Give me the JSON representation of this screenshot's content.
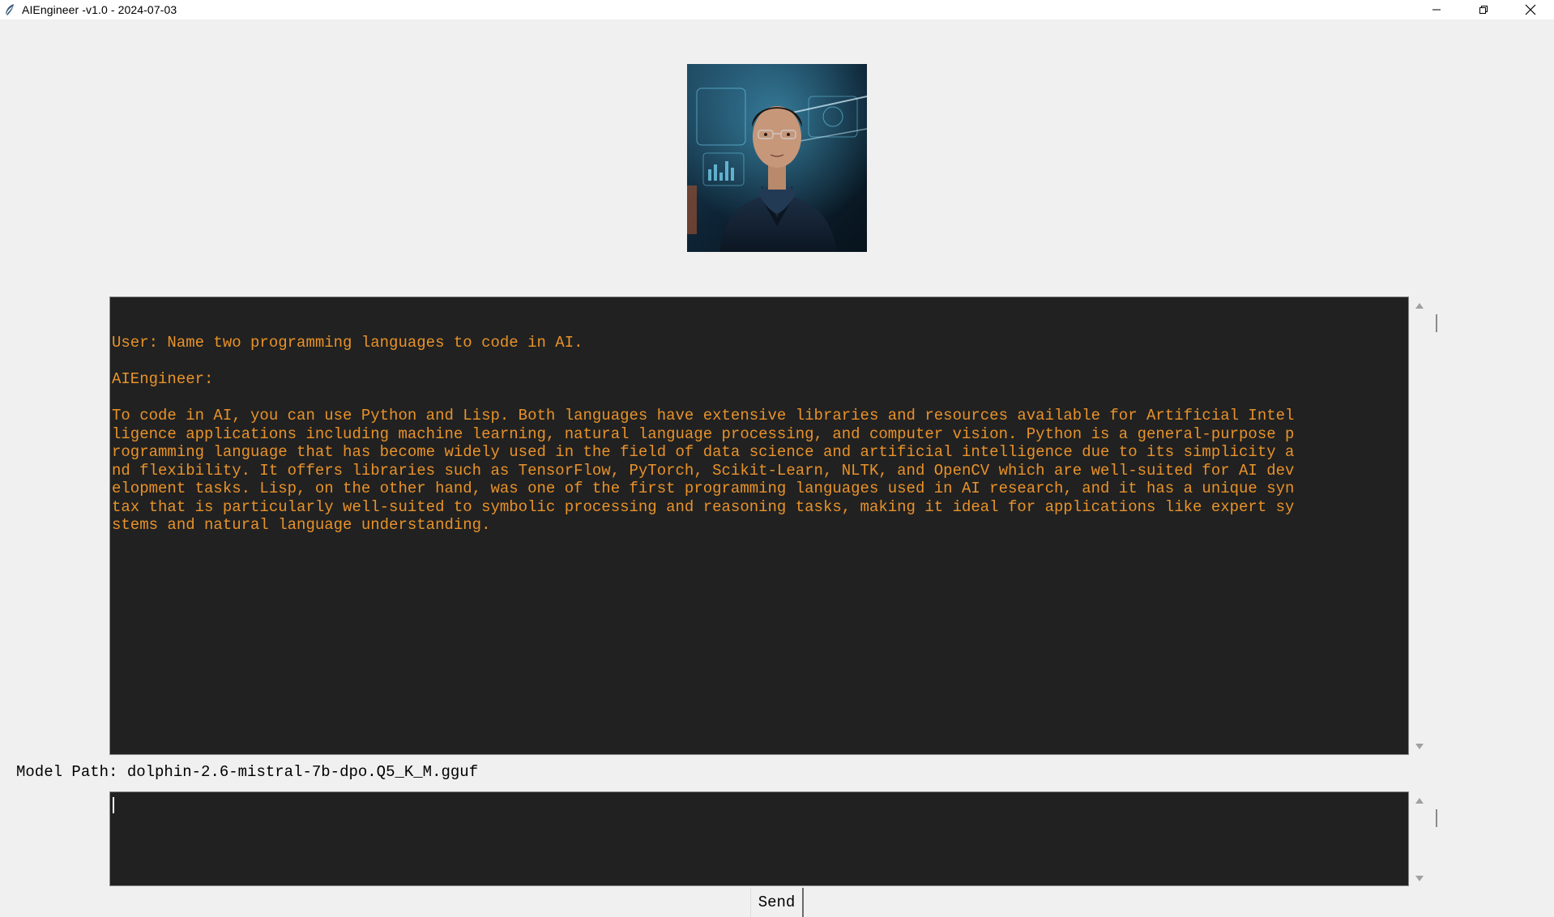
{
  "window": {
    "title": "AIEngineer -v1.0 - 2024-07-03",
    "app_icon": "feather-icon",
    "controls": [
      "minimize-icon",
      "restore-icon",
      "close-icon"
    ]
  },
  "avatar": {
    "alt": "AI Engineer avatar",
    "icon": "avatar-image"
  },
  "chat": {
    "user_line": "User: Name two programming languages to code in AI.",
    "assistant_label": "AIEngineer:",
    "response_lines": [
      "To code in AI, you can use Python and Lisp. Both languages have extensive libraries and resources available for Artificial Intel",
      "ligence applications including machine learning, natural language processing, and computer vision. Python is a general-purpose p",
      "rogramming language that has become widely used in the field of data science and artificial intelligence due to its simplicity a",
      "nd flexibility. It offers libraries such as TensorFlow, PyTorch, Scikit-Learn, NLTK, and OpenCV which are well-suited for AI dev",
      "elopment tasks. Lisp, on the other hand, was one of the first programming languages used in AI research, and it has a unique syn",
      "tax that is particularly well-suited to symbolic processing and reasoning tasks, making it ideal for applications like expert sy",
      "stems and natural language understanding."
    ]
  },
  "model_path": "Model Path: dolphin-2.6-mistral-7b-dpo.Q5_K_M.gguf",
  "input": {
    "value": ""
  },
  "send_button": {
    "label": "Send"
  },
  "colors": {
    "text_area_bg": "#212121",
    "chat_text": "#e8922a",
    "window_bg": "#f0f0f0"
  }
}
